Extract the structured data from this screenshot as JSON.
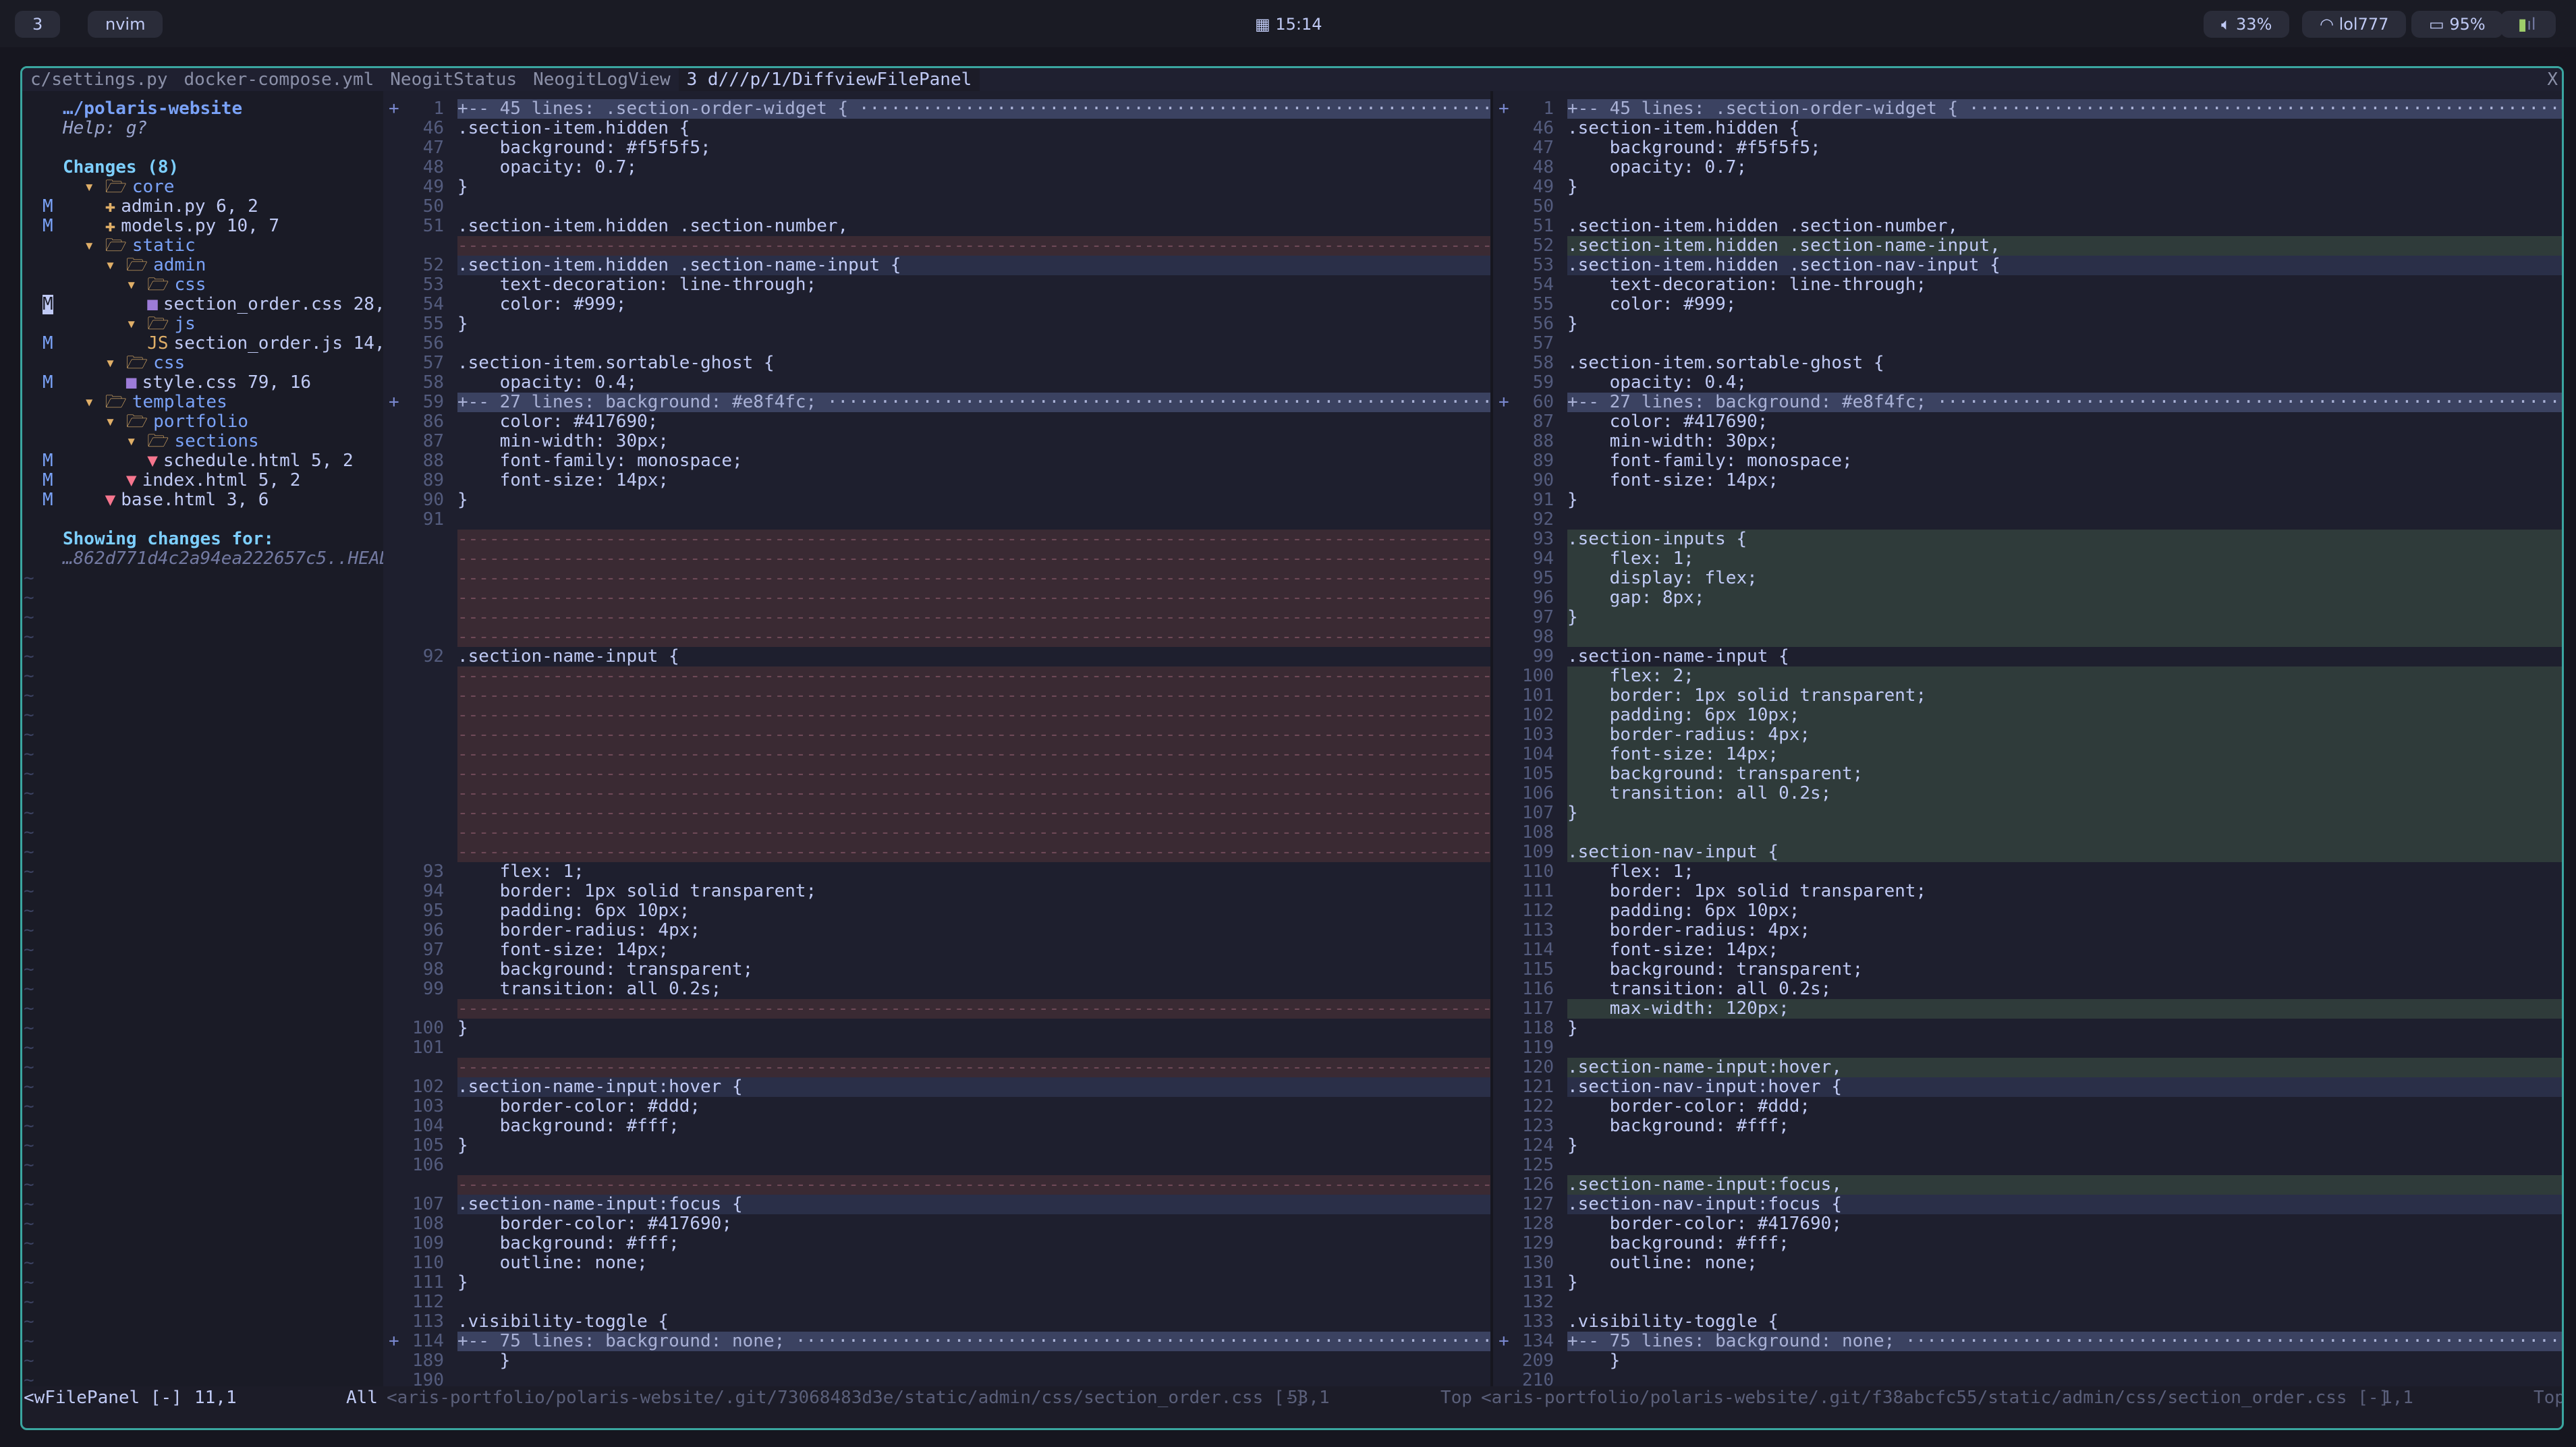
{
  "topbar": {
    "workspace": "3",
    "app": "nvim",
    "clock": "15:14",
    "volume": "33%",
    "wifi": "lol777",
    "battery": "95%"
  },
  "tabs": [
    "c/settings.py",
    "docker-compose.yml",
    "NeogitStatus",
    "NeogitLogView",
    "3 d///p/1/DiffviewFilePanel"
  ],
  "close_label": "X",
  "sidebar": {
    "rows": [
      {
        "s": "",
        "pre": "",
        "icon": "",
        "t": "…/polaris-website",
        "c": "#7aa2f7",
        "b": 1
      },
      {
        "s": "",
        "pre": "",
        "icon": "",
        "t": "Help: g?",
        "c": "#9aa5ce",
        "i": 1
      },
      {
        "s": "",
        "pre": "",
        "icon": "",
        "t": ""
      },
      {
        "s": "",
        "pre": "",
        "icon": "",
        "t": "Changes (8)",
        "c": "#7dcfff",
        "b": 1
      },
      {
        "s": "",
        "pre": "  ",
        "icon": "folder",
        "t": "core",
        "c": "#7aa2f7"
      },
      {
        "s": "M",
        "pre": "    ",
        "icon": "py",
        "t": "admin.py 6, 2"
      },
      {
        "s": "M",
        "pre": "    ",
        "icon": "py",
        "t": "models.py 10, 7"
      },
      {
        "s": "",
        "pre": "  ",
        "icon": "folder",
        "t": "static",
        "c": "#7aa2f7"
      },
      {
        "s": "",
        "pre": "    ",
        "icon": "folder",
        "t": "admin",
        "c": "#7aa2f7"
      },
      {
        "s": "",
        "pre": "      ",
        "icon": "folder",
        "t": "css",
        "c": "#7aa2f7"
      },
      {
        "s": "M",
        "pre": "        ",
        "icon": "css",
        "t": "section_order.css 28,",
        "sel": 1
      },
      {
        "s": "",
        "pre": "      ",
        "icon": "folder",
        "t": "js",
        "c": "#7aa2f7"
      },
      {
        "s": "M",
        "pre": "        ",
        "icon": "js",
        "t": "section_order.js 14,"
      },
      {
        "s": "",
        "pre": "    ",
        "icon": "folder",
        "t": "css",
        "c": "#7aa2f7"
      },
      {
        "s": "M",
        "pre": "      ",
        "icon": "css",
        "t": "style.css 79, 16"
      },
      {
        "s": "",
        "pre": "  ",
        "icon": "folder",
        "t": "templates",
        "c": "#7aa2f7"
      },
      {
        "s": "",
        "pre": "    ",
        "icon": "folder",
        "t": "portfolio",
        "c": "#7aa2f7"
      },
      {
        "s": "",
        "pre": "      ",
        "icon": "folder",
        "t": "sections",
        "c": "#7aa2f7"
      },
      {
        "s": "M",
        "pre": "        ",
        "icon": "html",
        "t": "schedule.html 5, 2"
      },
      {
        "s": "M",
        "pre": "      ",
        "icon": "html",
        "t": "index.html 5, 2"
      },
      {
        "s": "M",
        "pre": "    ",
        "icon": "html",
        "t": "base.html 3, 6"
      },
      {
        "s": "",
        "pre": "",
        "icon": "",
        "t": ""
      },
      {
        "s": "",
        "pre": "",
        "icon": "",
        "t": "Showing changes for:",
        "c": "#7dcfff",
        "b": 1
      },
      {
        "s": "",
        "pre": "",
        "icon": "",
        "t": "…862d771d4c2a94ea222657c5..HEAD",
        "c": "#737aa2",
        "i": 1
      }
    ]
  },
  "left": [
    [
      "+",
      "1",
      "+-- 45 lines: .section-order-widget {",
      "fold"
    ],
    [
      "",
      "46",
      ".section-item.hidden {",
      ""
    ],
    [
      "",
      "47",
      "    background: #f5f5f5;",
      ""
    ],
    [
      "",
      "48",
      "    opacity: 0.7;",
      ""
    ],
    [
      "",
      "49",
      "}",
      ""
    ],
    [
      "",
      "50",
      "",
      ""
    ],
    [
      "",
      "51",
      ".section-item.hidden .section-number,",
      ""
    ],
    [
      "",
      "",
      "",
      "fill"
    ],
    [
      "",
      "52",
      ".section-item.hidden .section-name-input {",
      "chg"
    ],
    [
      "",
      "53",
      "    text-decoration: line-through;",
      ""
    ],
    [
      "",
      "54",
      "    color: #999;",
      ""
    ],
    [
      "",
      "55",
      "}",
      ""
    ],
    [
      "",
      "56",
      "",
      ""
    ],
    [
      "",
      "57",
      ".section-item.sortable-ghost {",
      ""
    ],
    [
      "",
      "58",
      "    opacity: 0.4;",
      ""
    ],
    [
      "+",
      "59",
      "+-- 27 lines: background: #e8f4fc;",
      "fold"
    ],
    [
      "",
      "86",
      "    color: #417690;",
      ""
    ],
    [
      "",
      "87",
      "    min-width: 30px;",
      ""
    ],
    [
      "",
      "88",
      "    font-family: monospace;",
      ""
    ],
    [
      "",
      "89",
      "    font-size: 14px;",
      ""
    ],
    [
      "",
      "90",
      "}",
      ""
    ],
    [
      "",
      "91",
      "",
      ""
    ],
    [
      "",
      "",
      "",
      "fill"
    ],
    [
      "",
      "",
      "",
      "fill"
    ],
    [
      "",
      "",
      "",
      "fill"
    ],
    [
      "",
      "",
      "",
      "fill"
    ],
    [
      "",
      "",
      "",
      "fill"
    ],
    [
      "",
      "",
      "",
      "fill"
    ],
    [
      "",
      "92",
      ".section-name-input {",
      ""
    ],
    [
      "",
      "",
      "",
      "fill"
    ],
    [
      "",
      "",
      "",
      "fill"
    ],
    [
      "",
      "",
      "",
      "fill"
    ],
    [
      "",
      "",
      "",
      "fill"
    ],
    [
      "",
      "",
      "",
      "fill"
    ],
    [
      "",
      "",
      "",
      "fill"
    ],
    [
      "",
      "",
      "",
      "fill"
    ],
    [
      "",
      "",
      "",
      "fill"
    ],
    [
      "",
      "",
      "",
      "fill"
    ],
    [
      "",
      "",
      "",
      "fill"
    ],
    [
      "",
      "93",
      "    flex: 1;",
      ""
    ],
    [
      "",
      "94",
      "    border: 1px solid transparent;",
      ""
    ],
    [
      "",
      "95",
      "    padding: 6px 10px;",
      ""
    ],
    [
      "",
      "96",
      "    border-radius: 4px;",
      ""
    ],
    [
      "",
      "97",
      "    font-size: 14px;",
      ""
    ],
    [
      "",
      "98",
      "    background: transparent;",
      ""
    ],
    [
      "",
      "99",
      "    transition: all 0.2s;",
      ""
    ],
    [
      "",
      "",
      "",
      "fill"
    ],
    [
      "",
      "100",
      "}",
      ""
    ],
    [
      "",
      "101",
      "",
      ""
    ],
    [
      "",
      "",
      "",
      "fill"
    ],
    [
      "",
      "102",
      ".section-name-input:hover {",
      "chg"
    ],
    [
      "",
      "103",
      "    border-color: #ddd;",
      ""
    ],
    [
      "",
      "104",
      "    background: #fff;",
      ""
    ],
    [
      "",
      "105",
      "}",
      ""
    ],
    [
      "",
      "106",
      "",
      ""
    ],
    [
      "",
      "",
      "",
      "fill"
    ],
    [
      "",
      "107",
      ".section-name-input:focus {",
      "chg"
    ],
    [
      "",
      "108",
      "    border-color: #417690;",
      ""
    ],
    [
      "",
      "109",
      "    background: #fff;",
      ""
    ],
    [
      "",
      "110",
      "    outline: none;",
      ""
    ],
    [
      "",
      "111",
      "}",
      ""
    ],
    [
      "",
      "112",
      "",
      ""
    ],
    [
      "",
      "113",
      ".visibility-toggle {",
      ""
    ],
    [
      "+",
      "114",
      "+-- 75 lines: background: none;",
      "fold"
    ],
    [
      "",
      "189",
      "    }",
      ""
    ],
    [
      "",
      "190",
      "",
      ""
    ]
  ],
  "right": [
    [
      "+",
      "1",
      "+-- 45 lines: .section-order-widget {",
      "fold"
    ],
    [
      "",
      "46",
      ".section-item.hidden {",
      ""
    ],
    [
      "",
      "47",
      "    background: #f5f5f5;",
      ""
    ],
    [
      "",
      "48",
      "    opacity: 0.7;",
      ""
    ],
    [
      "",
      "49",
      "}",
      ""
    ],
    [
      "",
      "50",
      "",
      ""
    ],
    [
      "",
      "51",
      ".section-item.hidden .section-number,",
      ""
    ],
    [
      "",
      "52",
      ".section-item.hidden .section-name-input,",
      "add"
    ],
    [
      "",
      "53",
      ".section-item.hidden .section-nav-input {",
      "chg"
    ],
    [
      "",
      "54",
      "    text-decoration: line-through;",
      ""
    ],
    [
      "",
      "55",
      "    color: #999;",
      ""
    ],
    [
      "",
      "56",
      "}",
      ""
    ],
    [
      "",
      "57",
      "",
      ""
    ],
    [
      "",
      "58",
      ".section-item.sortable-ghost {",
      ""
    ],
    [
      "",
      "59",
      "    opacity: 0.4;",
      ""
    ],
    [
      "+",
      "60",
      "+-- 27 lines: background: #e8f4fc;",
      "fold"
    ],
    [
      "",
      "87",
      "    color: #417690;",
      ""
    ],
    [
      "",
      "88",
      "    min-width: 30px;",
      ""
    ],
    [
      "",
      "89",
      "    font-family: monospace;",
      ""
    ],
    [
      "",
      "90",
      "    font-size: 14px;",
      ""
    ],
    [
      "",
      "91",
      "}",
      ""
    ],
    [
      "",
      "92",
      "",
      ""
    ],
    [
      "",
      "93",
      ".section-inputs {",
      "add"
    ],
    [
      "",
      "94",
      "    flex: 1;",
      "add"
    ],
    [
      "",
      "95",
      "    display: flex;",
      "add"
    ],
    [
      "",
      "96",
      "    gap: 8px;",
      "add"
    ],
    [
      "",
      "97",
      "}",
      "add"
    ],
    [
      "",
      "98",
      "",
      "add"
    ],
    [
      "",
      "99",
      ".section-name-input {",
      ""
    ],
    [
      "",
      "100",
      "    flex: 2;",
      "add"
    ],
    [
      "",
      "101",
      "    border: 1px solid transparent;",
      "add"
    ],
    [
      "",
      "102",
      "    padding: 6px 10px;",
      "add"
    ],
    [
      "",
      "103",
      "    border-radius: 4px;",
      "add"
    ],
    [
      "",
      "104",
      "    font-size: 14px;",
      "add"
    ],
    [
      "",
      "105",
      "    background: transparent;",
      "add"
    ],
    [
      "",
      "106",
      "    transition: all 0.2s;",
      "add"
    ],
    [
      "",
      "107",
      "}",
      "add"
    ],
    [
      "",
      "108",
      "",
      "add"
    ],
    [
      "",
      "109",
      ".section-nav-input {",
      "add"
    ],
    [
      "",
      "110",
      "    flex: 1;",
      ""
    ],
    [
      "",
      "111",
      "    border: 1px solid transparent;",
      ""
    ],
    [
      "",
      "112",
      "    padding: 6px 10px;",
      ""
    ],
    [
      "",
      "113",
      "    border-radius: 4px;",
      ""
    ],
    [
      "",
      "114",
      "    font-size: 14px;",
      ""
    ],
    [
      "",
      "115",
      "    background: transparent;",
      ""
    ],
    [
      "",
      "116",
      "    transition: all 0.2s;",
      ""
    ],
    [
      "",
      "117",
      "    max-width: 120px;",
      "add"
    ],
    [
      "",
      "118",
      "}",
      ""
    ],
    [
      "",
      "119",
      "",
      ""
    ],
    [
      "",
      "120",
      ".section-name-input:hover,",
      "add"
    ],
    [
      "",
      "121",
      ".section-nav-input:hover {",
      "chg"
    ],
    [
      "",
      "122",
      "    border-color: #ddd;",
      ""
    ],
    [
      "",
      "123",
      "    background: #fff;",
      ""
    ],
    [
      "",
      "124",
      "}",
      ""
    ],
    [
      "",
      "125",
      "",
      ""
    ],
    [
      "",
      "126",
      ".section-name-input:focus,",
      "add"
    ],
    [
      "",
      "127",
      ".section-nav-input:focus {",
      "chg"
    ],
    [
      "",
      "128",
      "    border-color: #417690;",
      ""
    ],
    [
      "",
      "129",
      "    background: #fff;",
      ""
    ],
    [
      "",
      "130",
      "    outline: none;",
      ""
    ],
    [
      "",
      "131",
      "}",
      ""
    ],
    [
      "",
      "132",
      "",
      ""
    ],
    [
      "",
      "133",
      ".visibility-toggle {",
      ""
    ],
    [
      "+",
      "134",
      "+-- 75 lines: background: none;",
      "fold"
    ],
    [
      "",
      "209",
      "    }",
      ""
    ],
    [
      "",
      "210",
      "",
      ""
    ]
  ],
  "statusline": {
    "panel": "<wFilePanel [-]",
    "panel_pos": "11,1",
    "panel_scroll": "All",
    "left_path": "<aris-portfolio/polaris-website/.git/73068483d3e/static/admin/css/section_order.css [-]",
    "left_pos": "53,1",
    "left_scroll": "Top",
    "right_path": "<aris-portfolio/polaris-website/.git/f38abcfc55/static/admin/css/section_order.css [-]",
    "right_pos": "1,1",
    "right_scroll": "Top"
  },
  "colors": {
    "accent": "#3aa6a0",
    "add_bg": "#2f3b3a",
    "delete_fill_bg": "#3a2a33",
    "fold_bg": "#3b4261",
    "modified_flag": "#7aa2f7"
  }
}
